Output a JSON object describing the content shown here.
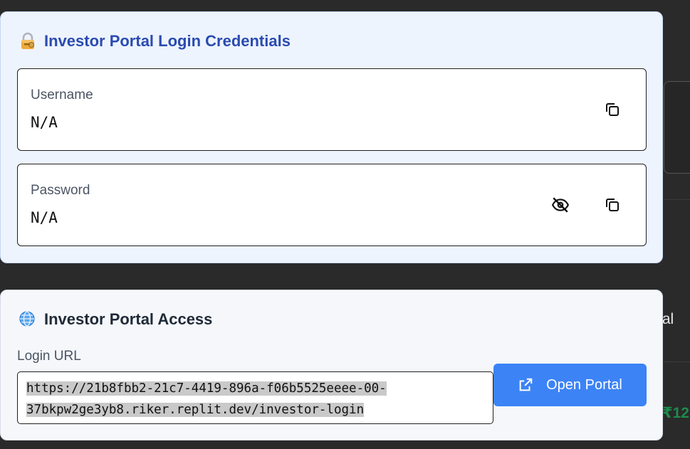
{
  "credentials": {
    "title": "Investor Portal Login Credentials",
    "title_icon": "lock-with-key-icon",
    "username": {
      "label": "Username",
      "value": "N/A"
    },
    "password": {
      "label": "Password",
      "value": "N/A"
    }
  },
  "access": {
    "title": "Investor Portal Access",
    "title_icon": "globe-icon",
    "url_label": "Login URL",
    "url_line1": "https://21b8fbb2-21c7-4419-896a-f06b5525eeee-00-",
    "url_line2": "37bkpw2ge3yb8.riker.replit.dev/investor-login",
    "open_button_label": "Open Portal"
  },
  "background": {
    "partial_text_1": "tal",
    "partial_text_2": "₹12"
  },
  "colors": {
    "accent_blue": "#3c83f6",
    "title_blue": "#2a4bb0",
    "card_bg_credentials": "#eef4fe",
    "card_bg_access": "#f5f7fb"
  }
}
